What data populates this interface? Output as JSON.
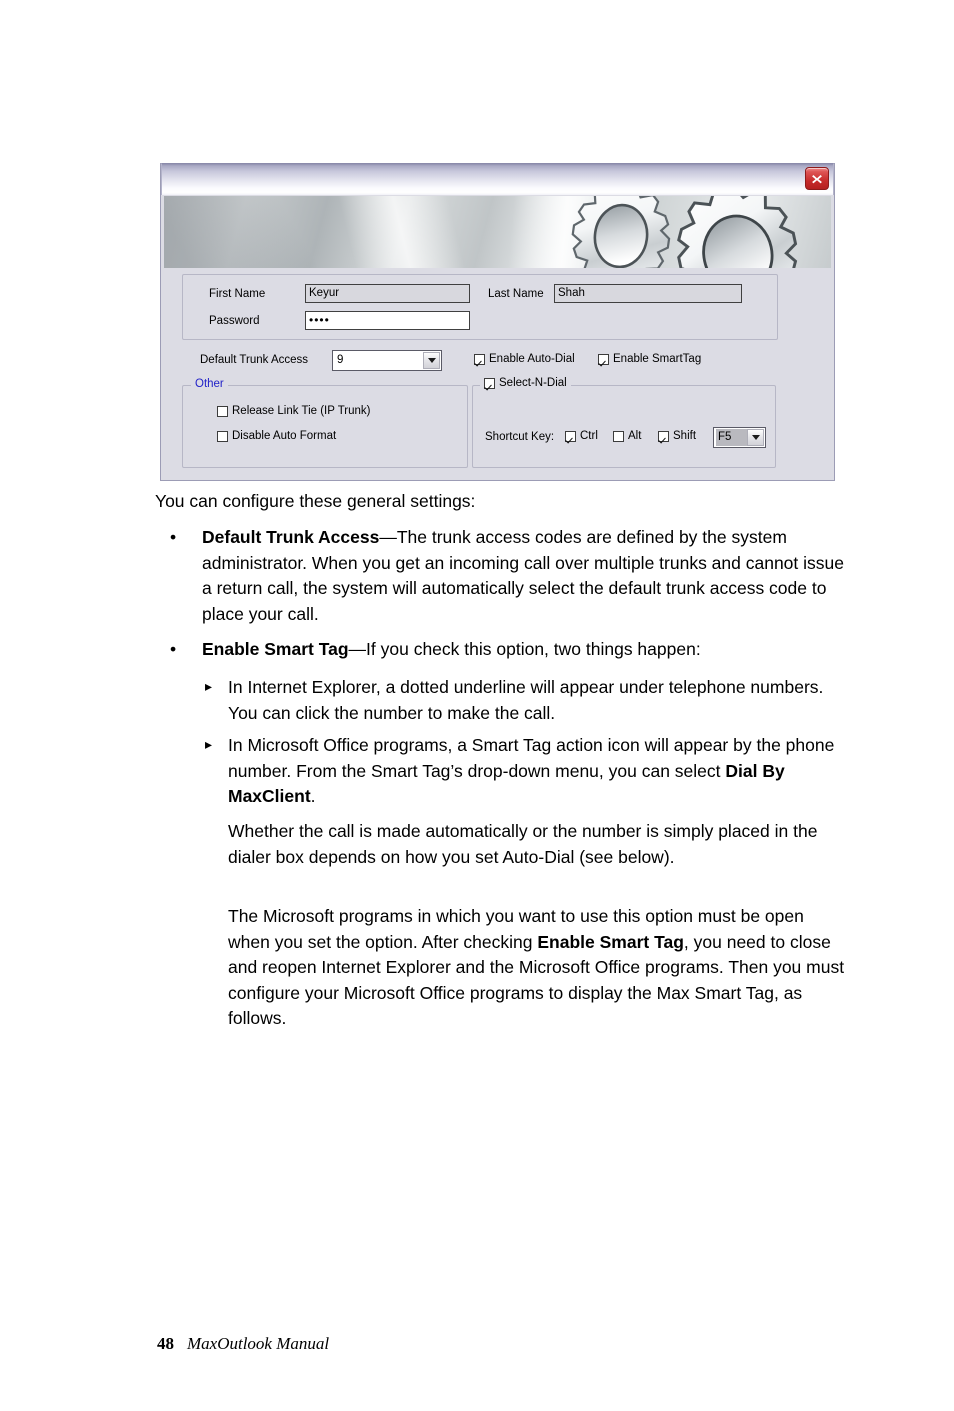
{
  "dialog": {
    "close_icon": "close-x-icon",
    "banner_icon": "gears-graphic",
    "fields": {
      "first_name_label": "First Name",
      "first_name_value": "Keyur",
      "last_name_label": "Last Name",
      "last_name_value": "Shah",
      "password_label": "Password",
      "password_value": "••••"
    },
    "trunk": {
      "label": "Default Trunk Access",
      "value": "9",
      "dropdown_icon": "chevron-down-icon"
    },
    "checkboxes": {
      "enable_auto_dial": "Enable Auto-Dial",
      "enable_auto_dial_checked": true,
      "enable_smarttag": "Enable SmartTag",
      "enable_smarttag_checked": true
    },
    "other_group": {
      "legend": "Other",
      "release_link_tie": "Release Link Tie (IP Trunk)",
      "release_link_tie_checked": false,
      "disable_auto_format": "Disable Auto Format",
      "disable_auto_format_checked": false
    },
    "select_n_dial_group": {
      "legend": "Select-N-Dial",
      "legend_checked": true,
      "shortcut_label": "Shortcut Key:",
      "ctrl": "Ctrl",
      "ctrl_checked": true,
      "alt": "Alt",
      "alt_checked": false,
      "shift": "Shift",
      "shift_checked": true,
      "key_value": "F5",
      "key_dropdown_icon": "chevron-down-icon"
    },
    "colors": {
      "legend_blue": "#2222c8",
      "dialog_face": "#dcdce4",
      "close_red": "#c62b2b"
    }
  },
  "body": {
    "intro": "You can configure these general settings:",
    "bullets": [
      {
        "marker": "•",
        "term": "Default Trunk Access",
        "text": "—The trunk access codes are defined by the system administrator. When you get an incoming call over multiple trunks and cannot issue a return call, the system will automatically select the default trunk access code to place your call."
      },
      {
        "marker": "•",
        "term": "Enable Smart Tag",
        "text": "—If you check this option, two things happen:"
      }
    ],
    "subbullets": [
      {
        "marker": "▸",
        "text": "In Internet Explorer, a dotted underline will appear under telephone numbers. You can click the number to make the call."
      },
      {
        "marker": "▸",
        "text_before": "In Microsoft Office programs, a Smart Tag action icon will appear by the phone number. From the Smart Tag’s drop-down menu, you can select ",
        "term": "Dial By MaxClient",
        "text_after": "."
      }
    ],
    "paragraphs": [
      "Whether the call is made automatically or the number is simply placed in the dialer box depends on how you set Auto-Dial (see below).",
      {
        "text_before": "The Microsoft programs in which you want to use this option must be open when you set the option. After checking ",
        "term": "Enable Smart Tag",
        "text_after": ", you need to close and reopen Internet Explorer and the Microsoft Office programs. Then you must configure your Microsoft Office programs to display the Max Smart Tag, as follows."
      }
    ]
  },
  "footer": {
    "page_number": "48",
    "document_title": "MaxOutlook Manual"
  }
}
